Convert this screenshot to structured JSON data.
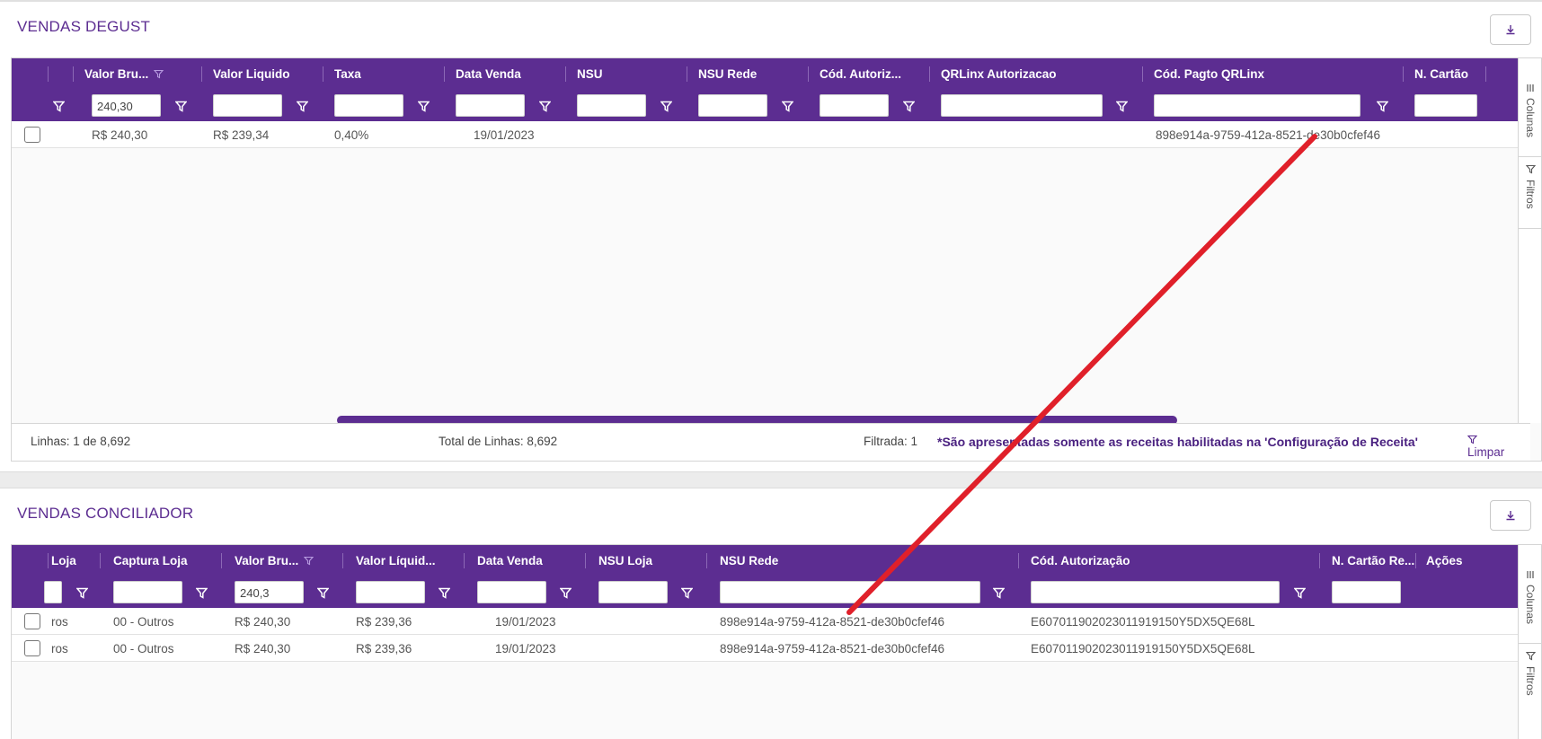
{
  "top": {
    "title": "VENDAS DEGUST",
    "columns": [
      "Valor Bru...",
      "Valor Liquido",
      "Taxa",
      "Data Venda",
      "NSU",
      "NSU Rede",
      "Cód. Autoriz...",
      "QRLinx Autorizacao",
      "Cód. Pagto QRLinx",
      "N. Cartão"
    ],
    "filter_value": "240,30",
    "row": {
      "valor_bruto": "R$ 240,30",
      "valor_liquido": "R$ 239,34",
      "taxa": "0,40%",
      "data_venda": "19/01/2023",
      "cod_pagto_qrlinx": "898e914a-9759-412a-8521-de30b0cfef46"
    },
    "footer": {
      "linhas": "Linhas: 1 de 8,692",
      "total": "Total de Linhas: 8,692",
      "filtrada": "Filtrada: 1",
      "note": "*São apresentadas somente as receitas habilitadas na 'Configuração de Receita'",
      "limpar": "Limpar"
    },
    "side": {
      "colunas": "Colunas",
      "filtros": "Filtros"
    }
  },
  "bottom": {
    "title": "VENDAS CONCILIADOR",
    "columns": [
      "Loja",
      "Captura Loja",
      "Valor Bru...",
      "Valor Líquid...",
      "Data Venda",
      "NSU Loja",
      "NSU Rede",
      "Cód. Autorização",
      "N. Cartão Re...",
      "Ações"
    ],
    "filter_value": "240,3",
    "rows": [
      {
        "loja": "ros",
        "captura": "00 - Outros",
        "valor_bruto": "R$ 240,30",
        "valor_liquido": "R$ 239,36",
        "data_venda": "19/01/2023",
        "nsu_rede": "898e914a-9759-412a-8521-de30b0cfef46",
        "cod_autorizacao": "E607011902023011919150Y5DX5QE68L"
      },
      {
        "loja": "ros",
        "captura": "00 - Outros",
        "valor_bruto": "R$ 240,30",
        "valor_liquido": "R$ 239,36",
        "data_venda": "19/01/2023",
        "nsu_rede": "898e914a-9759-412a-8521-de30b0cfef46",
        "cod_autorizacao": "E607011902023011919150Y5DX5QE68L"
      }
    ],
    "side": {
      "colunas": "Colunas",
      "filtros": "Filtros"
    }
  },
  "colors": {
    "brand": "#5c2d91",
    "annotation": "#e0202a"
  }
}
